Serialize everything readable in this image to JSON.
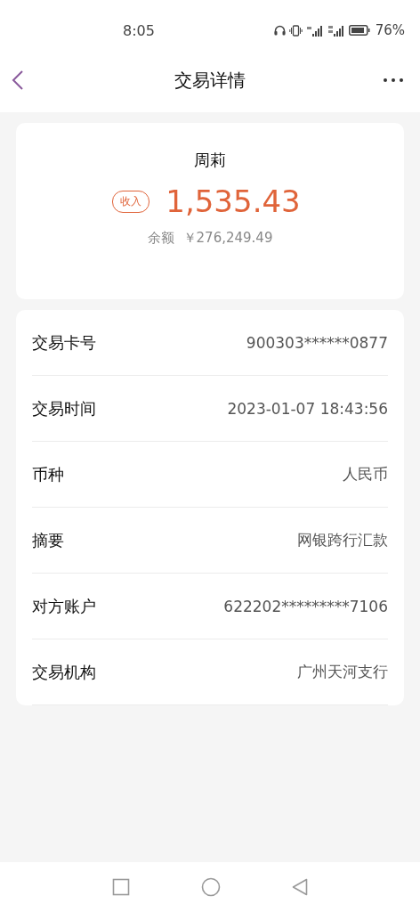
{
  "status_bar": {
    "time": "8:05",
    "battery_text": "76%"
  },
  "header": {
    "title": "交易详情"
  },
  "summary": {
    "name": "周莉",
    "tag": "收入",
    "amount": "1,535.43",
    "balance_label": "余额",
    "balance": "￥276,249.49"
  },
  "details": [
    {
      "label": "交易卡号",
      "value": "900303******0877"
    },
    {
      "label": "交易时间",
      "value": "2023-01-07 18:43:56"
    },
    {
      "label": "币种",
      "value": "人民币"
    },
    {
      "label": "摘要",
      "value": "网银跨行汇款"
    },
    {
      "label": "对方账户",
      "value": "622202*********7106"
    },
    {
      "label": "交易机构",
      "value": "广州天河支行"
    }
  ]
}
